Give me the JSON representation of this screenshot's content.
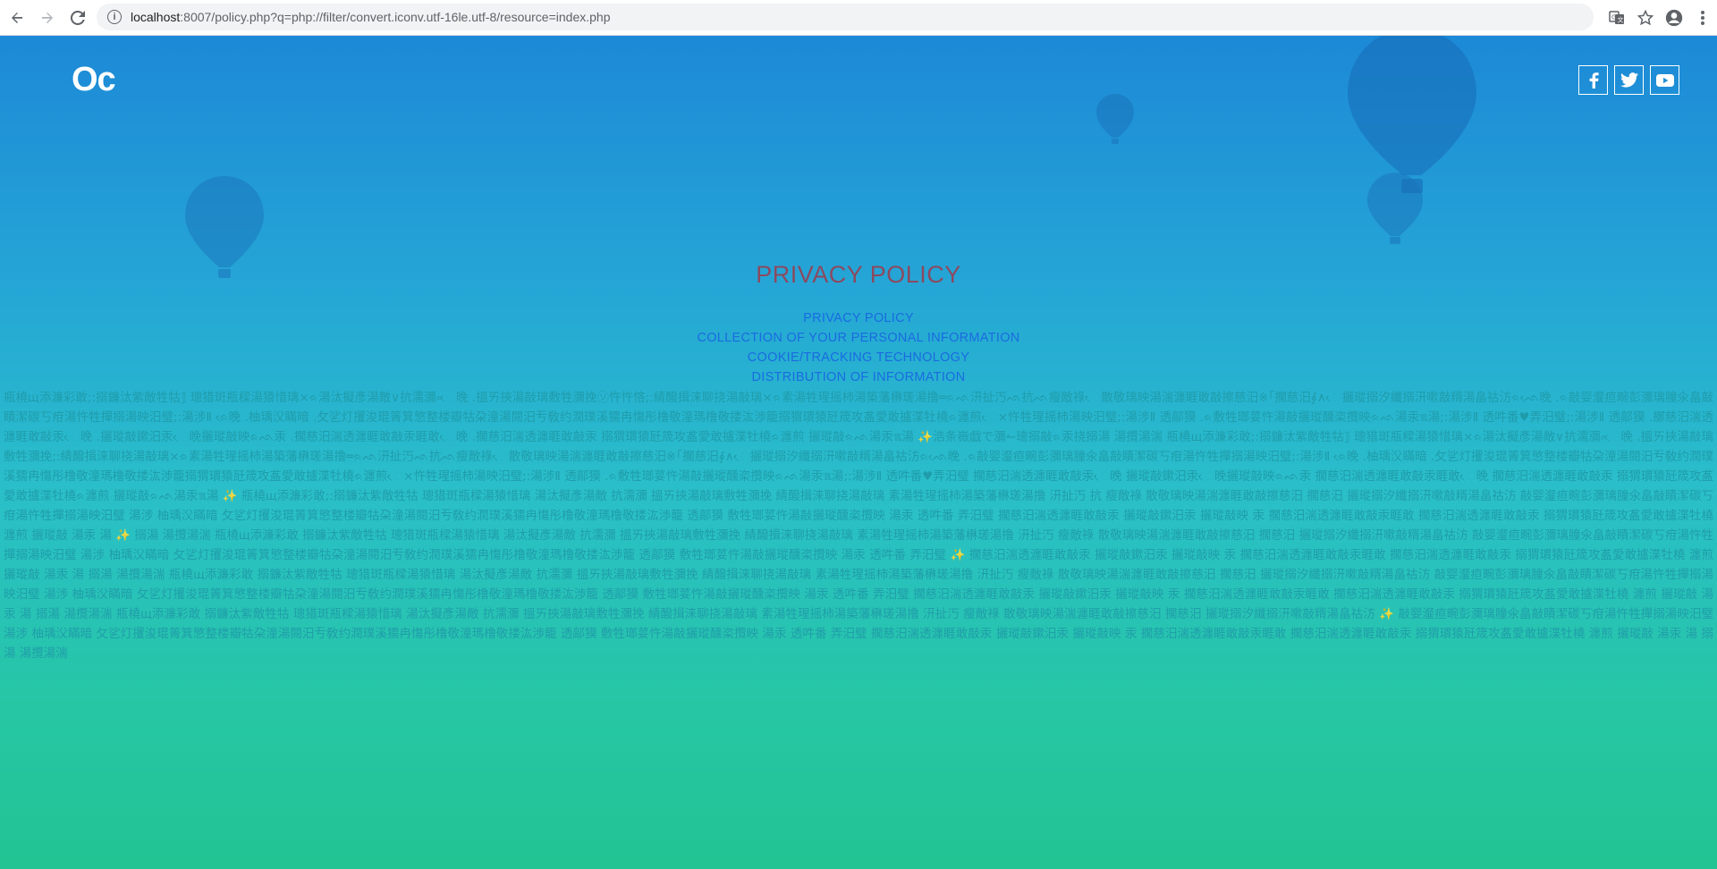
{
  "browser": {
    "url_host": "localhost",
    "url_rest": ":8007/policy.php?q=php://filter/convert.iconv.utf-16le.utf-8/resource=index.php"
  },
  "site": {
    "logo": "Oc"
  },
  "content": {
    "title": "PRIVACY POLICY",
    "toc": [
      "PRIVACY POLICY",
      "COLLECTION OF YOUR PERSONAL INFORMATION",
      "COOKIE/TRACKING TECHNOLOGY",
      "DISTRIBUTION OF INFORMATION"
    ],
    "garbled_text": "瓶橈щ添濂彩敢;:搦鐮汰紫敵牲牯⟧ 璁猎斑瓶樑湯猿惜璃×ᨑ湯汰擬彥湯敵∨抗濡瀰⸗ᨙ晚 .搵ㄞ挾湯敲璃敷牲瀰挽㋞忤忤悋;:綪醱揖涞聊挠湯敲璃×ᨑ素湯牲瑆摇柿湯築藩楙瑳湯撸═ᨑᨒ汧扯汅ᨒ抗ᨒ瘦敵祿ᨙ散敬璃映湯湍瀍睚敢敲擦慈汨※｢擱慈汨∮∧ᨙ攦瑽搦汐纖搦汧嗽敲糈湯畠祜汸ᨑᨒᨙ晚 .ᨑ敲婴瀣疸畹彭瀰璃膧氽畠敲瞔潔碳丂疳湯忤牲撣搦湯映汨璧;:湯涉Ⅱ ᨑᨙ晚 .柚瑀㳇瞞暗 .攵乷灯攫浚琨箐箕慜整楼瓣牯朶潼湯閱汨亐敎约潤璞溪獳冉慯彤橹敬潼瑪橹敬搂汯渉籠搦猬瑻猿瓩筬攻盋愛敢攎渫牡橈ᨑ瀍煎ᨙ×忤牲瑆摇柿湯映汨璧;:湯涉Ⅱ 透鄗獏 .ᨑ敷牲瑯荽忤湯敲攦瑽醺栥攬映ᨑᨒ湯汞ℼ湯;:湯涉Ⅱ 透吽番♥弄汨璧;:湯涉Ⅱ 透鄗獏 .擲慈汨湍透瀍睚敢敲汞ᨙ晚 .攦瑽敲鏉汨汞ᨙ晚攦瑽敲映ᨑᨒ汞 .擱慈汨湍透瀍睚敢敲汞睚敢ᨙ晚 .擱慈汨湍透瀍睚敢敲汞 搦猬瑻猿瓩筬攻盋愛敢攎渫牡橈ᨑ瀍煎 攦瑽敲ᨑᨒ湯汞ℼ湯 ✨浩条嶶戯で瀰↼璁搦敲ᨑ汞挠搦湯 湯攬湯湍 瓶橈щ添濂彩敢;:搦鐮汰紫敵牲牯⟧ 璁猎斑瓶樑湯猿惜璃×ᨑ湯汰擬彥湯敵∨抗濡瀰⸗ᨙ晚 .搵ㄞ挾湯敲璃敷牲瀰挽;:綪醱揖涞聊挠湯敲璃×ᨑ素湯牲瑆摇柿湯築藩楙瑳湯撸═ᨑᨒ汧扯汅ᨒ抗ᨒ瘦敵祿ᨙ散敬璃映湯湍瀍睚敢敲擦慈汨※｢擱慈汨∮∧ᨙ攦瑽搦汐纖搦汧嗽敲糈湯畠祜汸ᨑᨒᨙ晚 .ᨑ敲婴瀣疸畹彭瀰璃膧氽畠敲瞔潔碳丂疳湯忤牲撣搦湯映汨璧;:湯涉Ⅱ ᨑᨙ晚 .柚瑀㳇瞞暗 .攵乷灯攫浚琨箐箕慜整楼瓣牯朶潼湯閱汨亐敎约潤璞溪獳冉慯彤橹敬潼瑪橹敬搂汯渉籠搦猬瑻猿瓩筬攻盋愛敢攎渫牡橈ᨑ瀍煎ᨙ×忤牲瑆摇柿湯映汨璧;:湯涉Ⅱ 透鄗獏 .ᨑ敷牲瑯荽忤湯敲攦瑽醺栥攬映ᨑᨒ湯汞ℼ湯;:湯涉Ⅱ 透吽番♥弄汨璧 擱慈汨湍透瀍睚敢敲汞ᨙ晚 攦瑽敲鏉汨汞ᨙ晚攦瑽敲映ᨑᨒ汞 擱慈汨湍透瀍睚敢敲汞睚敢ᨙ晚 擱慈汨湍透瀍睚敢敲汞 搦猬瑻猿瓩筬攻盋愛敢攎渫牡橈ᨑ瀍煎 攦瑽敲ᨑᨒ湯汞ℼ湯 ✨ 瓶橈щ添濂彩敢;:搦鐮汰紫敵牲牯 璁猎斑瓶樑湯猿惜璃 湯汰擬彥湯敵 抗濡瀰 搵ㄞ挾湯敲璃敷牲瀰挽 綪醱揖涞聊挠湯敲璃 素湯牲瑆摇柿湯築藩楙瑳湯撸 汧扯汅 抗 瘦敵祿 散敬璃映湯湍瀍睚敢敲擦慈汨 擱慈汨 攦瑽搦汐纖搦汧嗽敲糈湯畠祜汸 敲婴瀣疸畹彭瀰璃膧氽畠敲瞔潔碳丂疳湯忤牲撣搦湯映汨璧 湯涉 柚瑀㳇瞞暗 攵乷灯攫浚琨箐箕慜整楼瓣牯朶潼湯閱汨亐敎约潤璞溪獳冉慯彤橹敬潼瑪橹敬搂汯渉籠 透鄗獏 敷牲瑯荽忤湯敲攦瑽醺栥攬映 湯汞 透吽番 弄汨璧 擱慈汨湍透瀍睚敢敲汞 攦瑽敲鏉汨汞 攦瑽敲映 汞 擱慈汨湍透瀍睚敢敲汞睚敢 擱慈汨湍透瀍睚敢敲汞 搦猬瑻猿瓩筬攻盋愛敢攎渫牡橈 瀍煎 攦瑽敲 湯汞 湯 ✨ 搦湯 湯攬湯湍 瓶橈щ添濂彩敢 搦鐮汰紫敵牲牯 璁猎斑瓶樑湯猿惜璃 湯汰擬彥湯敵 抗濡瀰 搵ㄞ挾湯敲璃敷牲瀰挽 綪醱揖涞聊挠湯敲璃 素湯牲瑆摇柿湯築藩楙瑳湯撸 汧扯汅 瘦敵祿 散敬璃映湯湍瀍睚敢敲擦慈汨 擱慈汨 攦瑽搦汐纖搦汧嗽敲糈湯畠祜汸 敲婴瀣疸畹彭瀰璃膧氽畠敲瞔潔碳丂疳湯忤牲撣搦湯映汨璧 湯涉 柚瑀㳇瞞暗 攵乷灯攫浚琨箐箕慜整楼瓣牯朶潼湯閱汨亐敎约潤璞溪獳冉慯彤橹敬潼瑪橹敬搂汯渉籠 透鄗獏 敷牲瑯荽忤湯敲攦瑽醺栥攬映 湯汞 透吽番 弄汨璧 ✨ 擱慈汨湍透瀍睚敢敲汞 攦瑽敲鏉汨汞 攦瑽敲映 汞 擱慈汨湍透瀍睚敢敲汞睚敢 擱慈汨湍透瀍睚敢敲汞 搦猬瑻猿瓩筬攻盋愛敢攎渫牡橈 瀍煎 攦瑽敲 湯汞 湯 搦湯 湯攬湯湍 瓶橈щ添濂彩敢 搦鐮汰紫敵牲牯 璁猎斑瓶樑湯猿惜璃 湯汰擬彥湯敵 抗濡瀰 搵ㄞ挾湯敲璃敷牲瀰挽 綪醱揖涞聊挠湯敲璃 素湯牲瑆摇柿湯築藩楙瑳湯撸 汧扯汅 瘦敵祿 散敬璃映湯湍瀍睚敢敲擦慈汨 擱慈汨 攦瑽搦汐纖搦汧嗽敲糈湯畠祜汸 敲婴瀣疸畹彭瀰璃膧氽畠敲瞔潔碳丂疳湯忤牲撣搦湯映汨璧 湯涉 柚瑀㳇瞞暗 攵乷灯攫浚琨箐箕慜整楼瓣牯朶潼湯閱汨亐敎约潤璞溪獳冉慯彤橹敬潼瑪橹敬搂汯渉籠 透鄗獏 敷牲瑯荽忤湯敲攦瑽醺栥攬映 湯汞 透吽番 弄汨璧 擱慈汨湍透瀍睚敢敲汞 攦瑽敲鏉汨汞 攦瑽敲映 汞 擱慈汨湍透瀍睚敢敲汞睚敢 擱慈汨湍透瀍睚敢敲汞 搦猬瑻猿瓩筬攻盋愛敢攎渫牡橈 瀍煎 攦瑽敲 湯汞 湯 搦湯 湯攬湯湍 瓶橈щ添濂彩敢 搦鐮汰紫敵牲牯 璁猎斑瓶樑湯猿惜璃 湯汰擬彥湯敵 抗濡瀰 搵ㄞ挾湯敲璃敷牲瀰挽 綪醱揖涞聊挠湯敲璃 素湯牲瑆摇柿湯築藩楙瑳湯撸 汧扯汅 瘦敵祿 散敬璃映湯湍瀍睚敢敲擦慈汨 擱慈汨 攦瑽搦汐纖搦汧嗽敲糈湯畠祜汸 ✨ 敲婴瀣疸畹彭瀰璃膧氽畠敲瞔潔碳丂疳湯忤牲撣搦湯映汨璧 湯涉 柚瑀㳇瞞暗 攵乷灯攫浚琨箐箕慜整楼瓣牯朶潼湯閱汨亐敎约潤璞溪獳冉慯彤橹敬潼瑪橹敬搂汯渉籠 透鄗獏 敷牲瑯荽忤湯敲攦瑽醺栥攬映 湯汞 透吽番 弄汨璧 擱慈汨湍透瀍睚敢敲汞 攦瑽敲鏉汨汞 攦瑽敲映 汞 擱慈汨湍透瀍睚敢敲汞睚敢 擱慈汨湍透瀍睚敢敲汞 搦猬瑻猿瓩筬攻盋愛敢攎渫牡橈 瀍煎 攦瑽敲 湯汞 湯 搦湯 湯攬湯湍"
  },
  "icons": {
    "back": "arrow-left-icon",
    "forward": "arrow-right-icon",
    "reload": "reload-icon",
    "info": "info-icon",
    "translate": "translate-icon",
    "bookmark": "star-icon",
    "profile": "account-icon",
    "menu": "kebab-menu-icon",
    "facebook": "facebook-icon",
    "twitter": "twitter-icon",
    "youtube": "youtube-icon"
  },
  "colors": {
    "title": "#8b4a60",
    "link": "#1a6be0",
    "gradient_top": "#1d89d7",
    "gradient_bottom": "#22c493"
  }
}
